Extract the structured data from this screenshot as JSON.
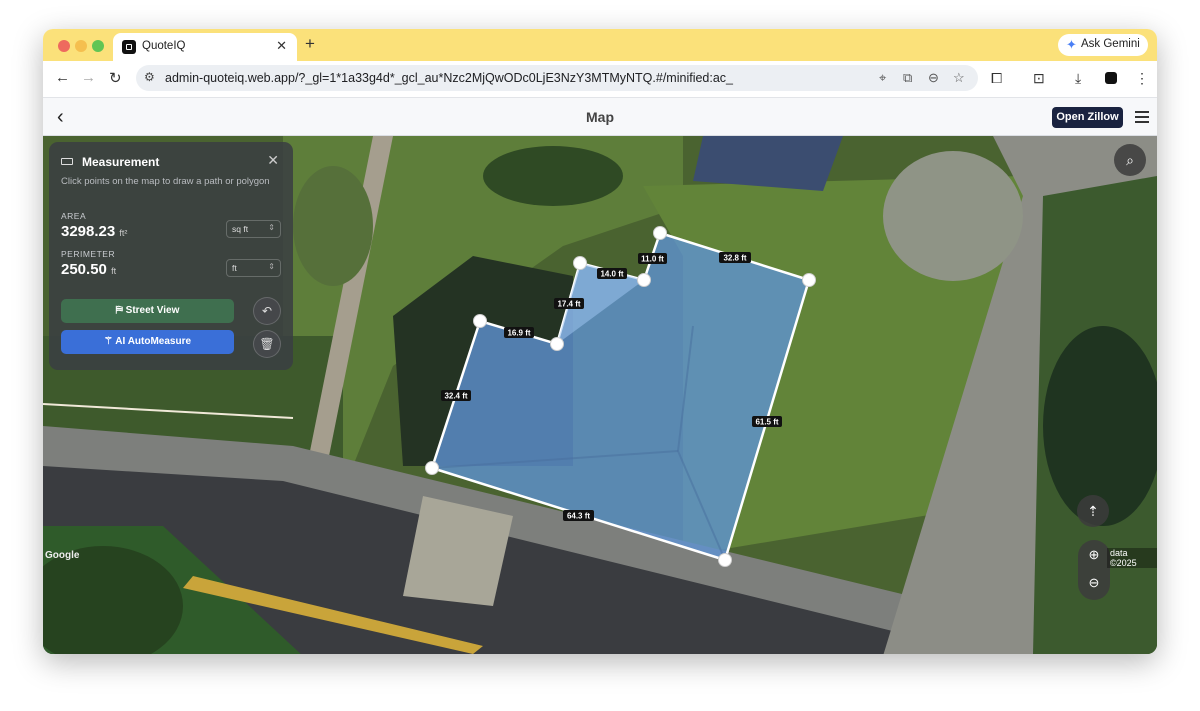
{
  "browser": {
    "tab_title": "QuoteIQ",
    "new_tab": "+",
    "close": "✕",
    "gemini_label": "Ask Gemini",
    "url": "admin-quoteiq.web.app/?_gl=1*1a33g4d*_gcl_au*Nzc2MjQwODc0LjE3NzY3MTMyNTQ.#/minified:ac_"
  },
  "header": {
    "title": "Map",
    "open_zillow": "Open Zillow"
  },
  "measurement": {
    "title": "Measurement",
    "hint": "Click points on the map to draw a path or polygon",
    "area_label": "AREA",
    "area_value": "3298.23",
    "area_unit": "ft²",
    "area_select": "sq ft",
    "perimeter_label": "PERIMETER",
    "perimeter_value": "250.50",
    "perimeter_unit": "ft",
    "perimeter_select": "ft",
    "street_view": "Street View",
    "ai_automeasure": "AI AutoMeasure"
  },
  "polygon_labels": [
    "14.0 ft",
    "11.0 ft",
    "32.8 ft",
    "17.4 ft",
    "16.9 ft",
    "32.4 ft",
    "61.5 ft",
    "64.3 ft"
  ],
  "map": {
    "attribution": "Google",
    "data_notice": "data ©2025"
  },
  "icons": {
    "search": "search-icon",
    "compass": "compass-icon",
    "zoom_in": "zoom-in-icon",
    "zoom_out": "zoom-out-icon",
    "undo": "undo-icon",
    "trash": "trash-icon"
  }
}
